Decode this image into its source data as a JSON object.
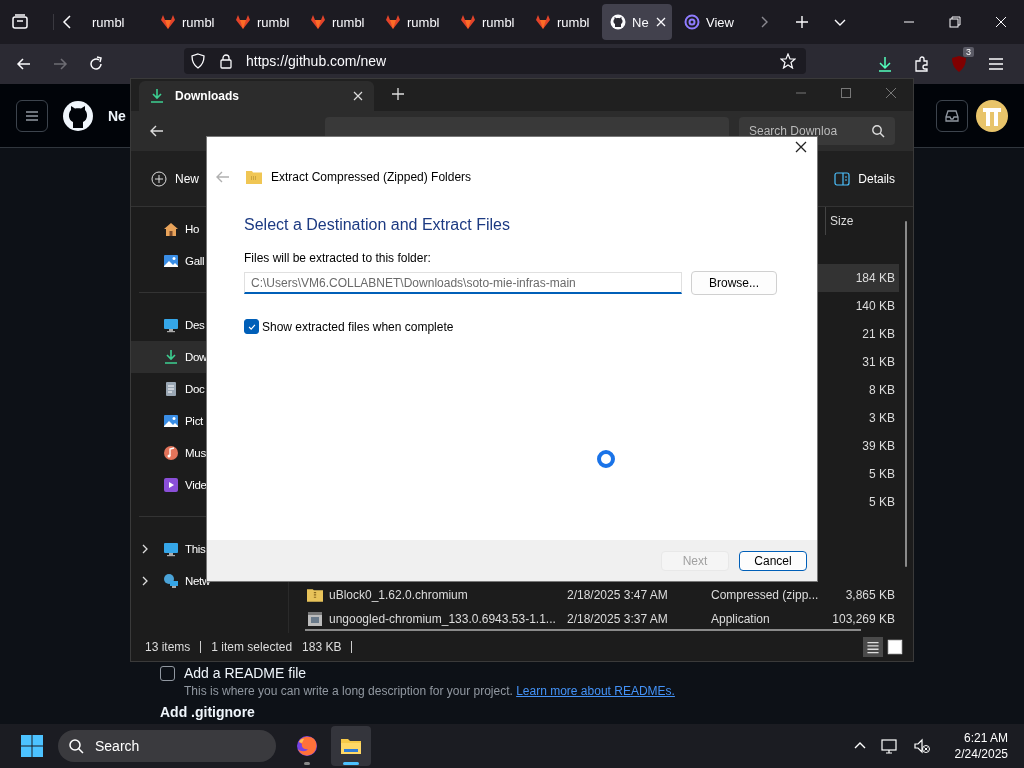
{
  "browser": {
    "tabs": [
      {
        "label": "rumbl",
        "kind": "plain",
        "selected": false
      },
      {
        "label": "rumbl",
        "kind": "gitlab",
        "selected": false
      },
      {
        "label": "rumbl",
        "kind": "gitlab",
        "selected": false
      },
      {
        "label": "rumbl",
        "kind": "gitlab",
        "selected": false
      },
      {
        "label": "rumbl",
        "kind": "gitlab",
        "selected": false
      },
      {
        "label": "rumbl",
        "kind": "gitlab",
        "selected": false
      },
      {
        "label": "rumbl",
        "kind": "gitlab",
        "selected": false
      },
      {
        "label": "Ne",
        "kind": "github",
        "selected": true
      },
      {
        "label": "View",
        "kind": "mention",
        "selected": false
      }
    ],
    "url": "https://github.com/new",
    "extension_badge": "3"
  },
  "github": {
    "page_title": "Ne",
    "readme": {
      "label": "Add a README file",
      "checked": false,
      "description": "This is where you can write a long description for your project. ",
      "link": "Learn more about READMEs."
    },
    "gitignore_heading": "Add .gitignore"
  },
  "explorer": {
    "tab_title": "Downloads",
    "search_placeholder": "Search Downloa",
    "new_label": "New",
    "details_label": "Details",
    "sidebar": [
      {
        "label": "Ho",
        "kind": "home",
        "selected": false,
        "expandable": false
      },
      {
        "label": "Gall",
        "kind": "gallery",
        "selected": false,
        "expandable": false
      },
      {
        "label": "Des",
        "kind": "desktop",
        "selected": false,
        "expandable": false
      },
      {
        "label": "Dow",
        "kind": "downloads",
        "selected": true,
        "expandable": false
      },
      {
        "label": "Doc",
        "kind": "documents",
        "selected": false,
        "expandable": false
      },
      {
        "label": "Pict",
        "kind": "pictures",
        "selected": false,
        "expandable": false
      },
      {
        "label": "Mus",
        "kind": "music",
        "selected": false,
        "expandable": false
      },
      {
        "label": "Vide",
        "kind": "videos",
        "selected": false,
        "expandable": false
      },
      {
        "label": "This",
        "kind": "pc",
        "selected": false,
        "expandable": true
      },
      {
        "label": "Netw",
        "kind": "network",
        "selected": false,
        "expandable": true
      }
    ],
    "size_header": "Size",
    "groups": [
      {
        "files": [
          {
            "size": "184 KB",
            "selected": true
          },
          {
            "size": "140 KB",
            "selected": false
          },
          {
            "size": "21 KB",
            "selected": false
          },
          {
            "size": "31 KB",
            "selected": false
          },
          {
            "size": "8 KB",
            "selected": false
          },
          {
            "size": "3 KB",
            "selected": false
          },
          {
            "size": "39 KB",
            "selected": false
          },
          {
            "size": "5 KB",
            "selected": false
          },
          {
            "size": "5 KB",
            "selected": false
          }
        ]
      },
      {
        "files": [
          {
            "name": "uBlock0_1.62.0.chromium",
            "date": "2/18/2025 3:47 AM",
            "type": "Compressed (zipp...",
            "size": "3,865 KB",
            "kind": "zip",
            "selected": false
          },
          {
            "name": "ungoogled-chromium_133.0.6943.53-1.1...",
            "date": "2/18/2025 3:37 AM",
            "type": "Application",
            "size": "103,269 KB",
            "kind": "app",
            "selected": false
          }
        ]
      }
    ],
    "status": {
      "items": "13 items",
      "selected": "1 item selected",
      "size": "183 KB"
    },
    "view_buttons": [
      {
        "kind": "list",
        "selected": true
      },
      {
        "kind": "tiles",
        "selected": false
      }
    ]
  },
  "dialog": {
    "title": "Extract Compressed (Zipped) Folders",
    "heading": "Select a Destination and Extract Files",
    "field_label": "Files will be extracted to this folder:",
    "path": "C:\\Users\\VM6.COLLABNET\\Downloads\\soto-mie-infras-main",
    "browse": "Browse...",
    "show_files": {
      "label": "Show extracted files when complete",
      "checked": true
    },
    "next": {
      "label": "Next",
      "disabled": true
    },
    "cancel": "Cancel"
  },
  "taskbar": {
    "search": "Search",
    "apps": [
      {
        "kind": "firefox",
        "selected": false
      },
      {
        "kind": "explorer",
        "selected": true
      }
    ],
    "time": "6:21 AM",
    "date": "2/24/2025"
  }
}
